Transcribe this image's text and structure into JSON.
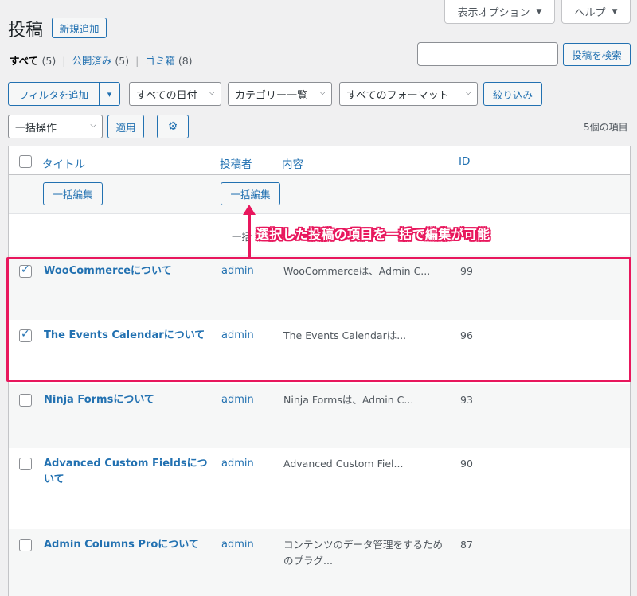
{
  "header": {
    "title": "投稿",
    "add_new": "新規追加",
    "screen_options": "表示オプション",
    "help": "ヘルプ"
  },
  "views": {
    "all_label": "すべて",
    "all_count": "(5)",
    "published_label": "公開済み",
    "published_count": "(5)",
    "trash_label": "ゴミ箱",
    "trash_count": "(8)",
    "separator": "|"
  },
  "search": {
    "value": "",
    "button": "投稿を検索"
  },
  "filters": {
    "add_filter": "フィルタを追加",
    "dropdown_arrow": "▾",
    "dates": "すべての日付",
    "categories": "カテゴリー一覧",
    "formats": "すべてのフォーマット",
    "filter_button": "絞り込み"
  },
  "bulk": {
    "action": "一括操作",
    "apply": "適用",
    "settings_icon": "⚙",
    "item_count": "5個の項目"
  },
  "columns": {
    "title": "タイトル",
    "author": "投稿者",
    "content": "内容",
    "id": "ID"
  },
  "bulk_edit_row": {
    "button1": "一括編集",
    "button2": "一括編集",
    "partial_text": "一括"
  },
  "posts": [
    {
      "checked": true,
      "title": "WooCommerceについて",
      "author": "admin",
      "content": "WooCommerceは、Admin C...",
      "id": "99"
    },
    {
      "checked": true,
      "title": "The Events Calendarについて",
      "author": "admin",
      "content": "The Events Calendarは...",
      "id": "96"
    },
    {
      "checked": false,
      "title": "Ninja Formsについて",
      "author": "admin",
      "content": "Ninja Formsは、Admin C...",
      "id": "93"
    },
    {
      "checked": false,
      "title": "Advanced Custom Fieldsについて",
      "author": "admin",
      "content": "Advanced Custom Fiel...",
      "id": "90"
    },
    {
      "checked": false,
      "title": "Admin Columns Proについて",
      "author": "admin",
      "content": "コンテンツのデータ管理をするためのプラグ...",
      "id": "87"
    }
  ],
  "annotation": {
    "text": "選択した投稿の項目を一括で編集が可能",
    "color": "#e8175d"
  },
  "colors": {
    "link": "#2271b1",
    "background": "#f0f0f1",
    "highlight": "#e8175d"
  }
}
